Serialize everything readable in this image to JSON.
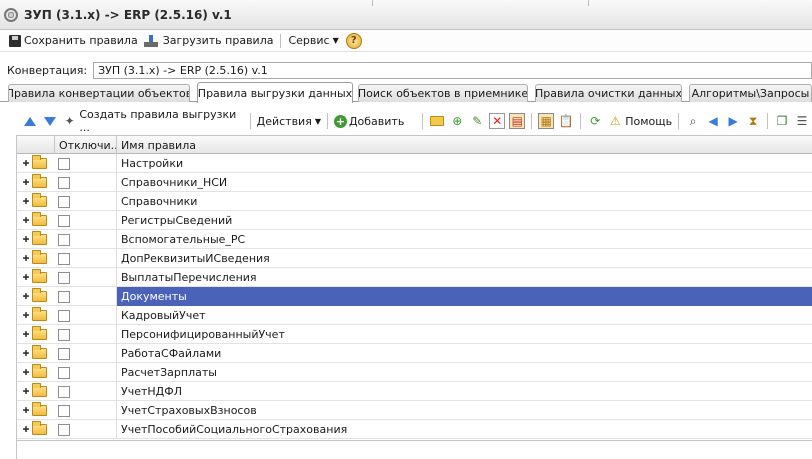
{
  "window": {
    "title": "ЗУП (3.1.x) -> ERP (2.5.16) v.1"
  },
  "menubar": {
    "save_label": "Сохранить правила",
    "load_label": "Загрузить правила",
    "service_label": "Сервис",
    "help_icon": "?"
  },
  "conversion": {
    "label": "Конвертация:",
    "value": "ЗУП (3.1.x) -> ERP (2.5.16) v.1"
  },
  "tabs": [
    {
      "label": "Правила конвертации объектов"
    },
    {
      "label": "Правила выгрузки данных"
    },
    {
      "label": "Поиск объектов в приемнике"
    },
    {
      "label": "Правила очистки данных"
    },
    {
      "label": "Алгоритмы\\Запросы"
    }
  ],
  "toolbar": {
    "create_rules_label": "Создать правила выгрузки ...",
    "actions_label": "Действия",
    "add_label": "Добавить",
    "help_label": "Помощь"
  },
  "grid": {
    "columns": [
      {
        "label": "Отключи..."
      },
      {
        "label": "Имя правила"
      }
    ],
    "rows": [
      {
        "name": "Настройки"
      },
      {
        "name": "Справочники_НСИ"
      },
      {
        "name": "Справочники"
      },
      {
        "name": "РегистрыСведений"
      },
      {
        "name": "Вспомогательные_РС"
      },
      {
        "name": "ДопРеквизитыИСведения"
      },
      {
        "name": "ВыплатыПеречисления"
      },
      {
        "name": "Документы"
      },
      {
        "name": "КадровыйУчет"
      },
      {
        "name": "ПерсонифицированныйУчет"
      },
      {
        "name": "РаботаСФайлами"
      },
      {
        "name": "РасчетЗарплаты"
      },
      {
        "name": "УчетНДФЛ"
      },
      {
        "name": "УчетСтраховыхВзносов"
      },
      {
        "name": "УчетПособийСоциальногоСтрахования"
      }
    ]
  }
}
